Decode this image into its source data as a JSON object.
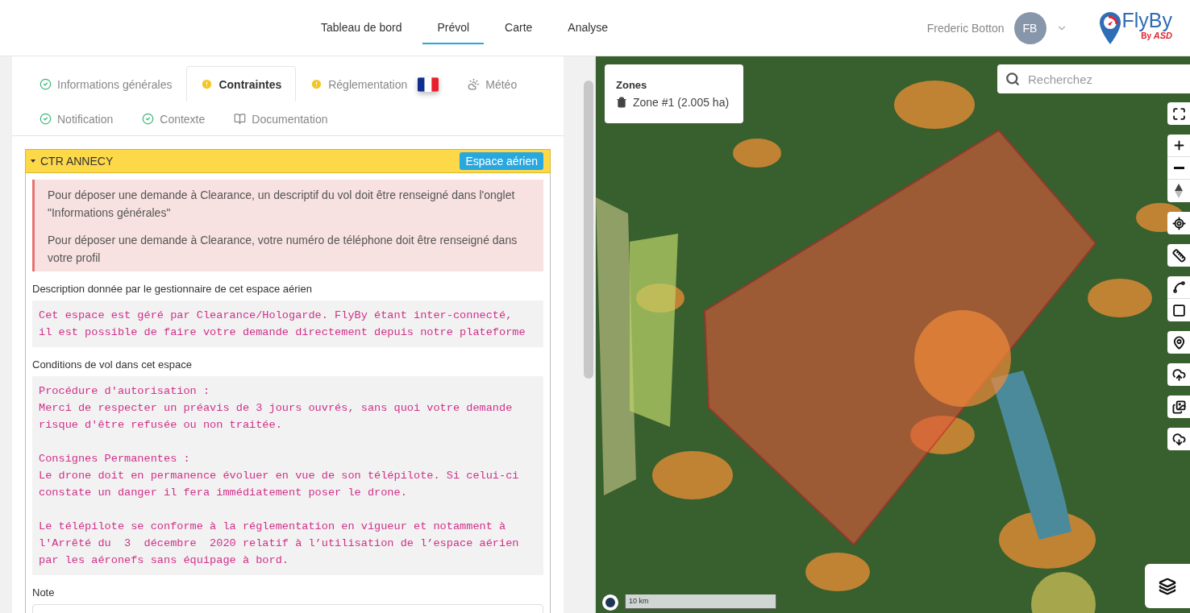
{
  "nav": [
    {
      "label": "Tableau de bord",
      "selected": false
    },
    {
      "label": "Prévol",
      "selected": true
    },
    {
      "label": "Carte",
      "selected": false
    },
    {
      "label": "Analyse",
      "selected": false
    }
  ],
  "user": {
    "name": "Frederic Botton",
    "initials": "FB"
  },
  "logo": {
    "name": "FlyBy",
    "by": "By",
    "brand": "ASD"
  },
  "tab_rows": [
    [
      {
        "label": "Informations générales",
        "kind": "check",
        "selected": false
      },
      {
        "label": "Contraintes",
        "kind": "warning",
        "selected": true
      },
      {
        "label": "Réglementation",
        "kind": "warning",
        "selected": false,
        "flag": true
      },
      {
        "label": "Météo",
        "kind": "weather",
        "selected": false
      }
    ],
    [
      {
        "label": "Notification",
        "kind": "check",
        "selected": false
      },
      {
        "label": "Contexte",
        "kind": "check",
        "selected": false
      },
      {
        "label": "Documentation",
        "kind": "book",
        "selected": false
      }
    ]
  ],
  "section": {
    "title": "CTR ANNECY",
    "badge": "Espace aérien",
    "expanded": true,
    "alerts": [
      "Pour déposer une demande à Clearance, un descriptif du vol doit être renseigné dans l'onglet \"Informations générales\"",
      "Pour déposer une demande à Clearance, votre numéro de téléphone doit être renseigné dans votre profil"
    ],
    "blocks": [
      {
        "label": "Description donnée par le gestionnaire de cet espace aérien",
        "text": "Cet espace est géré par Clearance/Hologarde. FlyBy étant inter-connecté,\nil est possible de faire votre demande directement depuis notre plateforme"
      },
      {
        "label": "Conditions de vol dans cet espace",
        "text": "Procédure d'autorisation :\nMerci de respecter un préavis de 3 jours ouvrés, sans quoi votre demande\nrisque d'être refusée ou non traitée.\n\nConsignes Permanentes :\nLe drone doit en permanence évoluer en vue de son télépilote. Si celui-ci\nconstate un danger il fera immédiatement poser le drone.\n\nLe télépilote se conforme à la réglementation en vigueur et notamment à\nl'Arrêté du  3  décembre  2020 relatif à l’utilisation de l’espace aérien\npar les aéronefs sans équipage à bord."
      }
    ],
    "note_label": "Note"
  },
  "map": {
    "search_placeholder": "Recherchez",
    "zones_title": "Zones",
    "zone": "Zone #1 (2.005 ha)",
    "scale": "10 km"
  }
}
